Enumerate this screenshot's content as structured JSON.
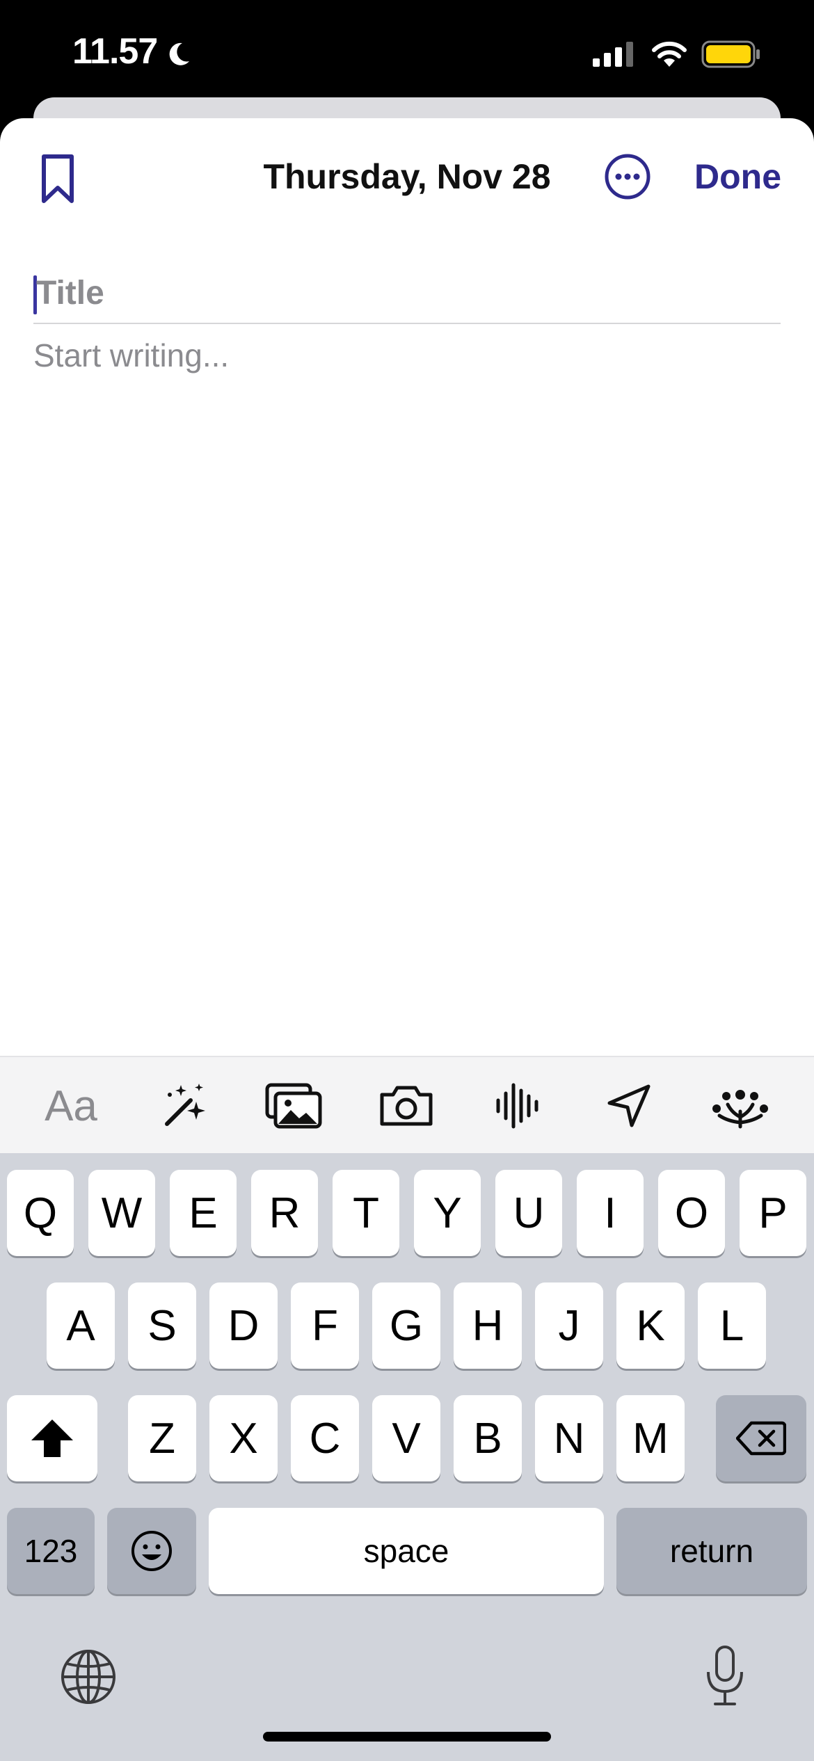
{
  "status_bar": {
    "time": "11.57"
  },
  "header": {
    "date": "Thursday, Nov 28",
    "done_label": "Done"
  },
  "editor": {
    "title_placeholder": "Title",
    "body_placeholder": "Start writing..."
  },
  "toolbar": {
    "text_format_label": "Aa",
    "items": [
      "magic-wand-icon",
      "photo-library-icon",
      "camera-icon",
      "audio-waveform-icon",
      "location-arrow-icon",
      "sparkle-burst-icon"
    ]
  },
  "keyboard": {
    "row1": [
      "Q",
      "W",
      "E",
      "R",
      "T",
      "Y",
      "U",
      "I",
      "O",
      "P"
    ],
    "row2": [
      "A",
      "S",
      "D",
      "F",
      "G",
      "H",
      "J",
      "K",
      "L"
    ],
    "row3": [
      "Z",
      "X",
      "C",
      "V",
      "B",
      "N",
      "M"
    ],
    "numbers_label": "123",
    "space_label": "space",
    "return_label": "return"
  },
  "colors": {
    "accent": "#2e2a8c",
    "battery": "#ffd60a",
    "keyboard_bg": "#d1d4db"
  }
}
